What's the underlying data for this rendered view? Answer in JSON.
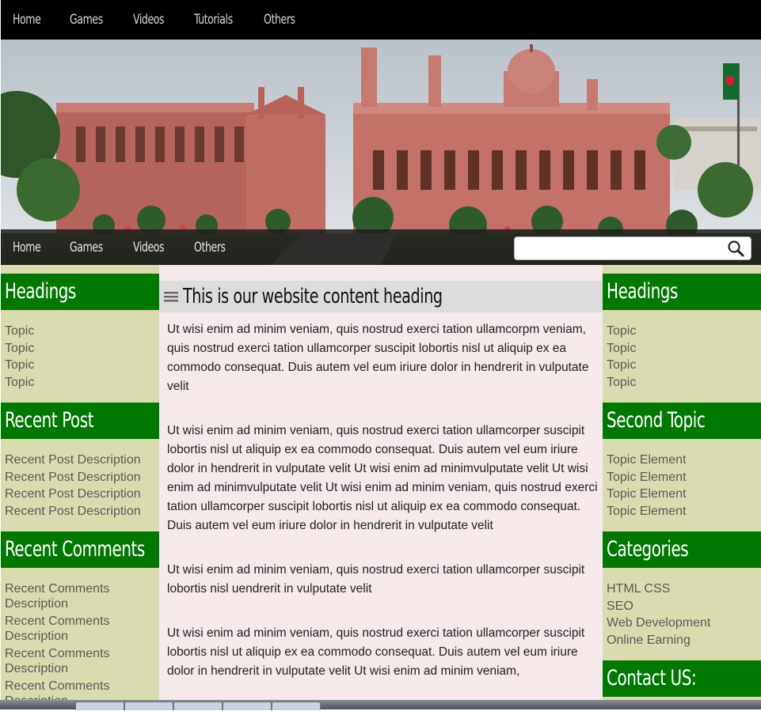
{
  "top_nav": [
    "Home",
    "Games",
    "Videos",
    "Tutorials",
    "Others"
  ],
  "second_nav": [
    "Home",
    "Games",
    "Videos",
    "Others"
  ],
  "search": {
    "placeholder": ""
  },
  "left_sidebar": {
    "headings": {
      "title": "Headings",
      "items": [
        "Topic",
        "Topic",
        "Topic",
        "Topic"
      ]
    },
    "recent_post": {
      "title": "Recent Post",
      "items": [
        "Recent Post Description",
        "Recent Post Description",
        "Recent Post Description",
        "Recent Post Description"
      ]
    },
    "recent_comments": {
      "title": "Recent Comments",
      "items": [
        "Recent Comments Description",
        "Recent Comments Description",
        "Recent Comments Description",
        "Recent Comments Description"
      ]
    }
  },
  "main": {
    "heading": "This is our website content heading",
    "paragraphs": [
      "Ut wisi enim ad minim veniam, quis nostrud exerci tation ullamcorpm veniam, quis nostrud exerci tation ullamcorper suscipit lobortis nisl ut aliquip ex ea commodo consequat. Duis autem vel eum iriure dolor in hendrerit in vulputate velit",
      "Ut wisi enim ad minim veniam, quis nostrud exerci tation ullamcorper suscipit lobortis nisl ut aliquip ex ea commodo consequat. Duis autem vel eum iriure dolor in hendrerit in vulputate velit Ut wisi enim ad minimvulputate velit Ut wisi enim ad minimvulputate velit Ut wisi enim ad minim veniam, quis nostrud exerci tation ullamcorper suscipit lobortis nisl ut aliquip ex ea commodo consequat. Duis autem vel eum iriure dolor in hendrerit in vulputate velit",
      "Ut wisi enim ad minim veniam, quis nostrud exerci tation ullamcorper suscipit lobortis nisl uendrerit in vulputate velit",
      "Ut wisi enim ad minim veniam, quis nostrud exerci tation ullamcorper suscipit lobortis nisl ut aliquip ex ea commodo consequat. Duis autem vel eum iriure dolor in hendrerit in vulputate velit Ut wisi enim ad minim veniam,"
    ]
  },
  "right_sidebar": {
    "headings": {
      "title": "Headings",
      "items": [
        "Topic",
        "Topic",
        "Topic",
        "Topic"
      ]
    },
    "second_topic": {
      "title": "Second Topic",
      "items": [
        "Topic Element",
        "Topic Element",
        "Topic Element",
        "Topic Element"
      ]
    },
    "categories": {
      "title": "Categories",
      "items": [
        "HTML CSS",
        "SEO",
        "Web Development",
        "Online Earning"
      ]
    },
    "contact": {
      "title": "Contact US:"
    }
  },
  "colors": {
    "widget_header": "#017801",
    "sidebar_bg": "#d8dcaf",
    "content_bg": "#f5e9e9",
    "nav_bg": "#000000"
  },
  "icons": {
    "search": "search-icon",
    "menu": "menu-icon"
  }
}
